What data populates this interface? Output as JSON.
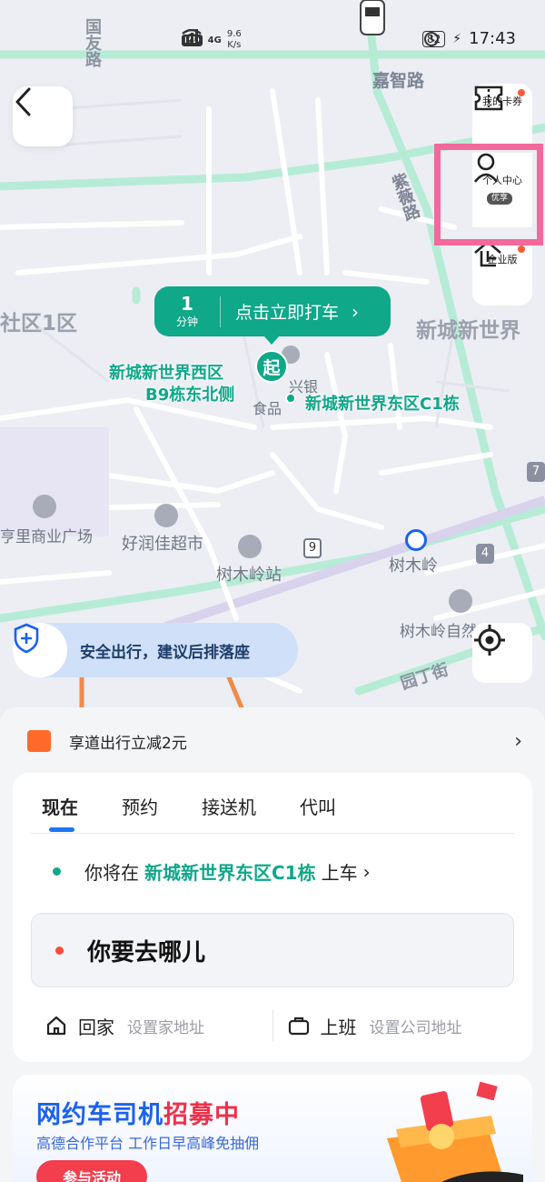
{
  "status_bar": {
    "network_badge": "HD",
    "network_type": "4G",
    "speed_value": "9.6",
    "speed_unit": "K/s",
    "battery": "82",
    "time": "17:43"
  },
  "map": {
    "road_labels": [
      "嘉智路",
      "紫薇路",
      "国友路",
      "园丁街"
    ],
    "area_labels": [
      "社区1区",
      "新城新世界"
    ],
    "poi_labels": [
      "亨里商业广场",
      "好润佳超市",
      "树木岭站",
      "树木岭",
      "树木岭自然",
      "兴银",
      "食品"
    ],
    "route_numbers": [
      "9",
      "4",
      "7"
    ],
    "start_pin": "起",
    "start_label_line1": "新城新世界西区",
    "start_label_line2": "B9栋东北侧",
    "pickup_marker_label": "新城新世界东区C1栋"
  },
  "side_buttons": [
    {
      "label": "我的卡券"
    },
    {
      "label": "个人中心",
      "tag": "优享"
    },
    {
      "label": "企业版"
    }
  ],
  "ride_pill": {
    "eta_number": "1",
    "eta_unit": "分钟",
    "action": "点击立即打车"
  },
  "safety_banner": "安全出行，建议后排落座",
  "promo": "享道出行立减2元",
  "tabs": [
    "现在",
    "预约",
    "接送机",
    "代叫"
  ],
  "pickup": {
    "prefix": "你将在",
    "place": "新城新世界东区C1栋",
    "suffix": "上车"
  },
  "destination_placeholder": "你要去哪儿",
  "shortcuts": [
    {
      "name": "回家",
      "hint": "设置家地址"
    },
    {
      "name": "上班",
      "hint": "设置公司地址"
    }
  ],
  "banner": {
    "title_part1": "网约车司机",
    "title_part2": "招募中",
    "subtitle": "高德合作平台 工作日早高峰免抽佣",
    "button": "参与活动"
  },
  "colors": {
    "accent_teal": "#0fa889",
    "accent_blue": "#1a76f5",
    "alert_red": "#f23e4d",
    "highlight_pink": "#f2699c",
    "road_green": "#b6ecd6"
  }
}
